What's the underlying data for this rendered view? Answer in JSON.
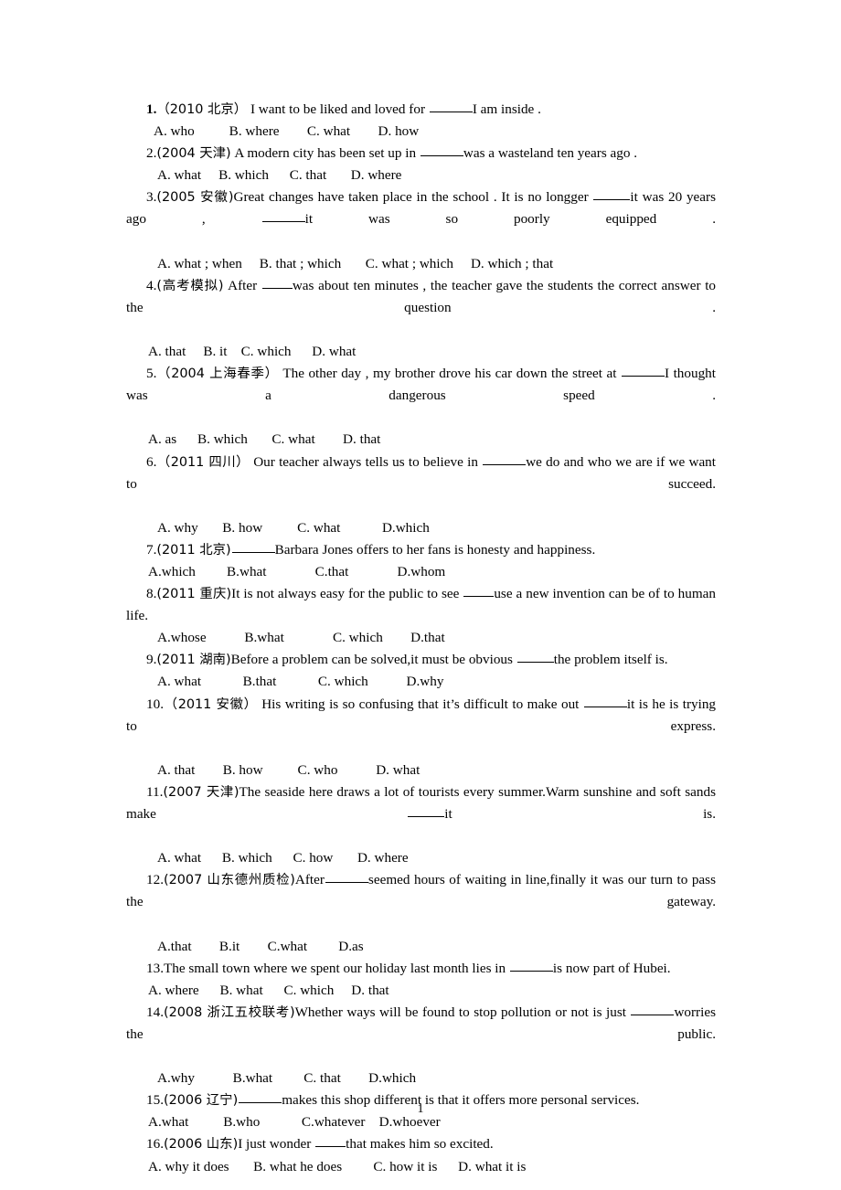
{
  "document": {
    "page_number": "1",
    "blank_marker": "_____"
  },
  "questions": [
    {
      "stem_prefix": "1",
      "stem_punct": ".",
      "source": "（2010 北京）",
      "stem_before": " I want to be liked and loved for ",
      "stem_after": "I am inside .",
      "options": "A. who          B. where        C. what        D. how"
    },
    {
      "stem_prefix": "2",
      "stem_punct": ".",
      "source": "(2004 天津)",
      "stem_before": " A modern city has been set up in ",
      "stem_after": "was a wasteland ten years ago .",
      "options": "A. what     B. which      C. that       D. where"
    },
    {
      "stem_prefix": "3",
      "stem_punct": ".",
      "source": "(2005 安徽)",
      "stem_before": "Great changes have taken place in the school . It is no longger ",
      "stem_mid": "it was 20 years ago , ",
      "stem_after": "it was so poorly equipped .",
      "options": "A. what ; when     B. that ; which       C. what ; which     D. which ; that"
    },
    {
      "stem_prefix": "4",
      "stem_punct": ".",
      "source": "(高考模拟)",
      "stem_before": " After ",
      "stem_after": "was about ten minutes , the teacher gave the students the correct answer to the question .",
      "options": "A. that     B. it    C. which      D. what"
    },
    {
      "stem_prefix": "5",
      "stem_punct": ".",
      "source": "（2004 上海春季）",
      "stem_before": " The other day , my brother drove his car down the street at ",
      "stem_after": "I thought was a dangerous speed .",
      "options": "A. as      B. which       C. what        D. that"
    },
    {
      "stem_prefix": "6",
      "stem_punct": ".",
      "source": "（2011 四川）",
      "stem_before": " Our teacher always tells us to believe in ",
      "stem_after": "we do and who we are if we want to succeed.",
      "options": "A. why       B. how          C. what            D.which"
    },
    {
      "stem_prefix": "7",
      "stem_punct": ".",
      "source": "(2011 北京)",
      "stem_before": "",
      "stem_after": "Barbara Jones offers to her fans is honesty and happiness.",
      "options": "A.which         B.what              C.that              D.whom"
    },
    {
      "stem_prefix": "8",
      "stem_punct": ".",
      "source": "(2011 重庆)",
      "stem_before": "It is not always easy for the public to see ",
      "stem_after": "use a new invention can be of to human life.",
      "options": "A.whose           B.what              C. which        D.that"
    },
    {
      "stem_prefix": "9",
      "stem_punct": ".",
      "source": "(2011 湖南)",
      "stem_before": "Before a problem can be solved,it must be obvious ",
      "stem_after": "the problem itself is.",
      "options": "A. what            B.that            C. which           D.why"
    },
    {
      "stem_prefix": "10",
      "stem_punct": ".",
      "source": "（2011 安徽）",
      "stem_before": " His writing is so confusing that it’s difficult to make out ",
      "stem_after": "it is he is trying to express.",
      "options": "A. that        B. how          C. who           D. what"
    },
    {
      "stem_prefix": "11",
      "stem_punct": ".",
      "source": "(2007 天津)",
      "stem_before": "The seaside here draws a lot of tourists every summer.Warm sunshine and soft sands make ",
      "stem_after": "it is.",
      "options": "A. what      B. which      C. how       D. where"
    },
    {
      "stem_prefix": "12",
      "stem_punct": ".",
      "source": "(2007 山东德州质检)",
      "stem_before": "After",
      "stem_after": "seemed hours of waiting in line,finally it was our turn to pass the gateway.",
      "options": "A.that        B.it        C.what         D.as"
    },
    {
      "stem_prefix": "13",
      "stem_punct": ".",
      "source": "",
      "stem_before": "The small town where we spent our holiday last month lies in ",
      "stem_after": "is now part of Hubei.",
      "options": "A. where      B. what      C. which     D. that"
    },
    {
      "stem_prefix": "14",
      "stem_punct": ".",
      "source": "(2008 浙江五校联考)",
      "stem_before": "Whether ways will be found to stop pollution or not is just ",
      "stem_after": "worries the public.",
      "options": "A.why           B.what         C. that        D.which"
    },
    {
      "stem_prefix": "15",
      "stem_punct": ".",
      "source": "(2006 辽宁)",
      "stem_before": "",
      "stem_after": "makes this shop different is that it offers more personal services.",
      "options": "A.what          B.who            C.whatever    D.whoever"
    },
    {
      "stem_prefix": "16",
      "stem_punct": ".",
      "source": "(2006 山东)",
      "stem_before": "I just wonder ",
      "stem_after": "that makes him so excited.",
      "options": "A. why it does       B. what he does         C. how it is      D. what it is"
    }
  ]
}
